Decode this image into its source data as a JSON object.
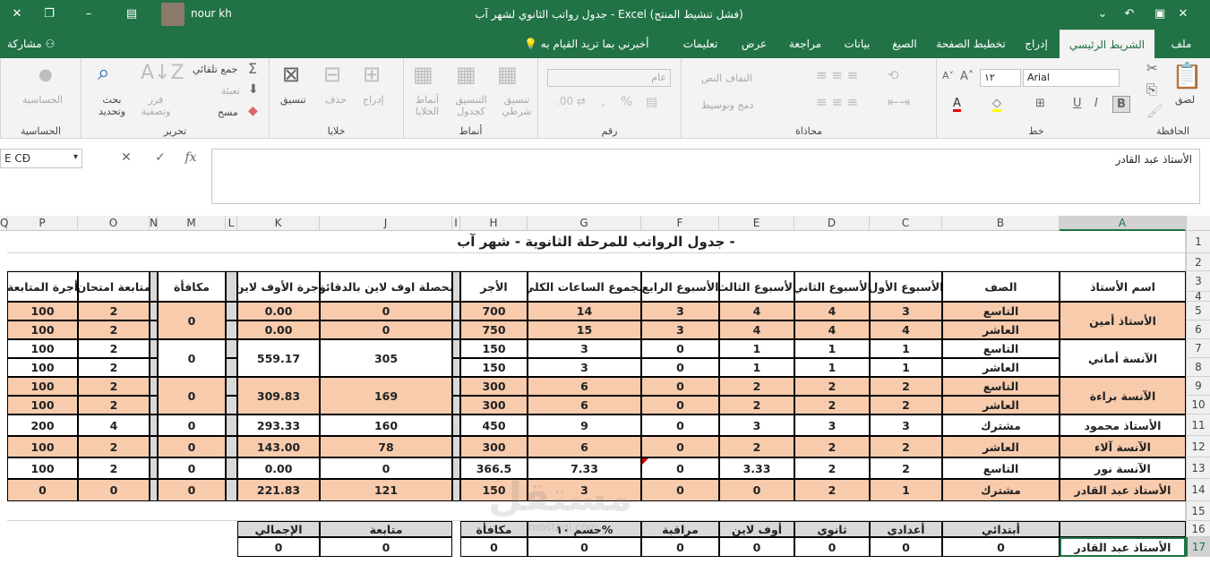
{
  "window": {
    "title": "جدول رواتب الثانوي لشهر آب  -  Excel (فشل تنشيط المنتج)",
    "user_name": "nour kh",
    "minimize": "–",
    "restore": "❐",
    "close": "✕",
    "ribbon_display": "▣"
  },
  "tabs": [
    {
      "label": "ملف"
    },
    {
      "label": "الشريط الرئيسي",
      "active": true
    },
    {
      "label": "إدراج"
    },
    {
      "label": "تخطيط الصفحة"
    },
    {
      "label": "الصيغ"
    },
    {
      "label": "بيانات"
    },
    {
      "label": "مراجعة"
    },
    {
      "label": "عرض"
    },
    {
      "label": "تعليمات"
    }
  ],
  "tell_me": "أخبرني بما تريد القيام به",
  "share": "مشاركة",
  "ribbon": {
    "clipboard": {
      "label": "الحافظة",
      "paste": "لصق"
    },
    "font": {
      "label": "خط",
      "name": "Arial",
      "size": "١٢"
    },
    "alignment": {
      "label": "محاذاة",
      "wrap": "التفاف النص",
      "merge": "دمج وتوسيط"
    },
    "number": {
      "label": "رقم",
      "format": "عام"
    },
    "styles": {
      "label": "أنماط",
      "conditional": "تنسيق شرطي",
      "table": "التنسيق كجدول",
      "cell": "أنماط الخلايا"
    },
    "cells": {
      "label": "خلايا",
      "insert": "إدراج",
      "delete": "حذف",
      "format": "تنسيق"
    },
    "editing": {
      "label": "تحرير",
      "autosum": "جمع تلقائي",
      "fill": "تعبئة",
      "clear": "مسح",
      "sort": "فرز وتصفية",
      "find": "بحث وتحديد"
    },
    "sensitivity": {
      "label": "الحساسية",
      "button": "الحساسية"
    }
  },
  "formula_bar": {
    "name_box": "E CĐ",
    "cancel": "✕",
    "enter": "✓",
    "fx": "fx",
    "content": "الأستاذ عبد القادر"
  },
  "columns": [
    "A",
    "B",
    "C",
    "D",
    "E",
    "F",
    "G",
    "H",
    "I",
    "J",
    "K",
    "L",
    "M",
    "N",
    "O",
    "P",
    "Q"
  ],
  "rows": [
    "1",
    "2",
    "3",
    "4",
    "5",
    "6",
    "7",
    "8",
    "9",
    "10",
    "11",
    "12",
    "13",
    "14",
    "15",
    "16",
    "17"
  ],
  "sheet": {
    "title": "جدول الرواتب للمرحلة الثانوية - شهر آب -",
    "headers": {
      "teacher": "اسم الأستاذ",
      "class": "الصف",
      "w1": "الأسبوع الأول",
      "w2": "الأسبوع الثاني",
      "w3": "الأسبوع الثالث",
      "w4": "الأسبوع الرابع",
      "total_hours": "مجموع الساعات الكلي",
      "wage": "الأجر",
      "online_minutes": "محصلة اوف لاين بالدقائق",
      "online_wage": "أجرة الأوف لاين",
      "bonus": "مكافأة",
      "exam_follow": "متابعة امتحان",
      "follow_wage": "أجرة المتابعة"
    },
    "teachers": [
      {
        "name": "الأستاذ أمين",
        "bonus": "0"
      },
      {
        "name": "الآنسة أماني",
        "bonus": "0",
        "minutes": "305",
        "owage": "559.17"
      },
      {
        "name": "الآنسة براءة",
        "bonus": "0",
        "minutes": "169",
        "owage": "309.83"
      },
      {
        "name": "الأستاذ محمود"
      },
      {
        "name": "الآنسة آلاء"
      },
      {
        "name": "الآنسة نور"
      },
      {
        "name": "الأستاذ عبد القادر"
      }
    ],
    "data_rows": [
      {
        "class": "التاسع",
        "w1": "3",
        "w2": "4",
        "w3": "4",
        "w4": "3",
        "total": "14",
        "wage": "700",
        "minutes": "0",
        "owage": "0.00",
        "exam": "2",
        "fwage": "100"
      },
      {
        "class": "العاشر",
        "w1": "4",
        "w2": "4",
        "w3": "4",
        "w4": "3",
        "total": "15",
        "wage": "750",
        "minutes": "0",
        "owage": "0.00",
        "exam": "2",
        "fwage": "100"
      },
      {
        "class": "التاسع",
        "w1": "1",
        "w2": "1",
        "w3": "1",
        "w4": "0",
        "total": "3",
        "wage": "150",
        "exam": "2",
        "fwage": "100"
      },
      {
        "class": "العاشر",
        "w1": "1",
        "w2": "1",
        "w3": "1",
        "w4": "0",
        "total": "3",
        "wage": "150",
        "exam": "2",
        "fwage": "100"
      },
      {
        "class": "التاسع",
        "w1": "2",
        "w2": "2",
        "w3": "2",
        "w4": "0",
        "total": "6",
        "wage": "300",
        "exam": "2",
        "fwage": "100"
      },
      {
        "class": "العاشر",
        "w1": "2",
        "w2": "2",
        "w3": "2",
        "w4": "0",
        "total": "6",
        "wage": "300",
        "exam": "2",
        "fwage": "100"
      },
      {
        "class": "مشترك",
        "w1": "3",
        "w2": "3",
        "w3": "3",
        "w4": "0",
        "total": "9",
        "wage": "450",
        "minutes": "160",
        "owage": "293.33",
        "bonus": "0",
        "exam": "4",
        "fwage": "200"
      },
      {
        "class": "العاشر",
        "w1": "2",
        "w2": "2",
        "w3": "2",
        "w4": "0",
        "total": "6",
        "wage": "300",
        "minutes": "78",
        "owage": "143.00",
        "bonus": "0",
        "exam": "2",
        "fwage": "100"
      },
      {
        "class": "التاسع",
        "w1": "2",
        "w2": "2",
        "w3": "3.33",
        "w4": "0",
        "total": "7.33",
        "wage": "366.5",
        "minutes": "0",
        "owage": "0.00",
        "bonus": "0",
        "exam": "2",
        "fwage": "100"
      },
      {
        "class": "مشترك",
        "w1": "1",
        "w2": "2",
        "w3": "0",
        "w4": "0",
        "total": "3",
        "wage": "150",
        "minutes": "121",
        "owage": "221.83",
        "bonus": "0",
        "exam": "0",
        "fwage": "0"
      }
    ],
    "summary": {
      "headers": [
        "أبتدائي",
        "أعدادي",
        "ثانوي",
        "أوف لاين",
        "مراقبة",
        "حسم ١٠%",
        "مكافأة",
        "متابعة",
        "الإجمالي"
      ],
      "values": [
        "0",
        "0",
        "0",
        "0",
        "0",
        "0",
        "0",
        "0",
        "0"
      ],
      "selected_label": "الأستاذ عبد القادر"
    }
  },
  "watermark": "مستقل",
  "watermark_url": "mostaql.com",
  "colors": {
    "excel_green": "#217346",
    "peach": "#f8cbad",
    "gray": "#d9d9d9"
  }
}
